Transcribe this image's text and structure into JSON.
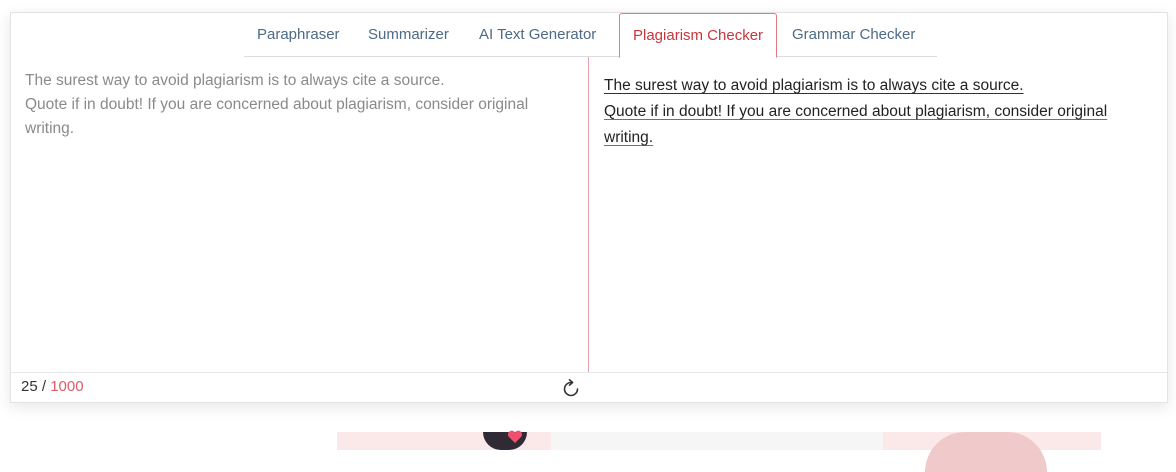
{
  "tabs": [
    {
      "label": "Paraphraser"
    },
    {
      "label": "Summarizer"
    },
    {
      "label": "AI Text Generator"
    },
    {
      "label": "Plagiarism Checker"
    },
    {
      "label": "Grammar Checker"
    }
  ],
  "active_tab": "Plagiarism Checker",
  "input": {
    "line1": "The surest way to avoid plagiarism is to always cite a source.",
    "line2": "Quote if in doubt! If you are concerned about plagiarism, consider original writing."
  },
  "output": {
    "line1": "The surest way to avoid plagiarism is to always cite a source.",
    "line2": "Quote if in doubt! If you are concerned about plagiarism, consider original writing."
  },
  "counter": {
    "current": "25 /",
    "max": "1000"
  },
  "icons": {
    "refresh": "refresh-icon"
  },
  "colors": {
    "active_tab": "#c8363c",
    "tab_text": "#4e6a86",
    "counter_max": "#e05a68",
    "divider": "#e4a3a7"
  }
}
